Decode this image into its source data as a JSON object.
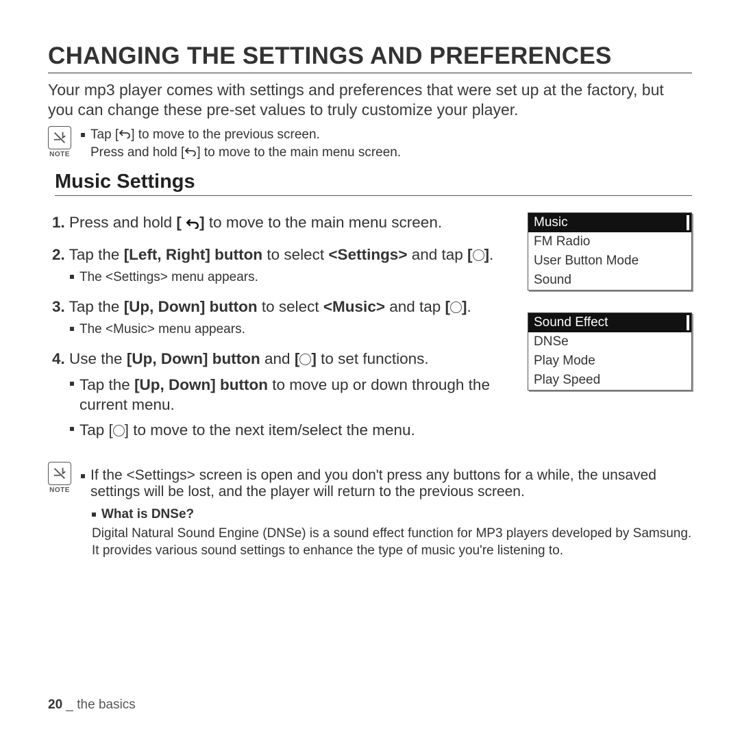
{
  "title": "CHANGING THE SETTINGS AND PREFERENCES",
  "intro": "Your mp3 player comes with settings and preferences that were set up at the factory, but you can change these pre-set values to truly customize your player.",
  "topNote": {
    "label": "NOTE",
    "l1a": "Tap [",
    "l1b": "] to move to the previous screen.",
    "l2a": "Press and hold [",
    "l2b": "] to move to the main menu screen."
  },
  "subheading": "Music Settings",
  "steps": {
    "s1": {
      "num": "1.",
      "a": "Press and hold ",
      "b": "[",
      "c": "]",
      "d": " to move to the main menu screen."
    },
    "s2": {
      "num": "2.",
      "a": "Tap the ",
      "bold1": "[Left, Right] button",
      "b": " to select ",
      "bold2": "<Settings>",
      "c": " and tap ",
      "d": "[",
      "e": "]",
      "f": ".",
      "sub": "The <Settings> menu appears."
    },
    "s3": {
      "num": "3.",
      "a": "Tap the ",
      "bold1": "[Up, Down] button",
      "b": " to select ",
      "bold2": "<Music>",
      "c": " and tap ",
      "d": "[",
      "e": "]",
      "f": ".",
      "sub": "The <Music> menu appears."
    },
    "s4": {
      "num": "4.",
      "a": "Use the ",
      "bold1": "[Up, Down] button",
      "b": " and ",
      "c": "[",
      "d": "]",
      "e": " to set functions.",
      "sub1a": "Tap the ",
      "sub1bold": "[Up, Down] button",
      "sub1b": " to move up or down through the current menu.",
      "sub2a": "Tap [",
      "sub2b": "] to move to the next item/select the menu."
    }
  },
  "screens": {
    "a": {
      "r1": "Music",
      "r2": "FM Radio",
      "r3": "User Button Mode",
      "r4": "Sound"
    },
    "b": {
      "r1": "Sound Effect",
      "r2": "DNSe",
      "r3": "Play Mode",
      "r4": "Play Speed"
    }
  },
  "bottomNote": {
    "label": "NOTE",
    "text": "If the <Settings> screen is open and you don't press any buttons for a while, the unsaved settings will be lost, and the player will return to the previous screen.",
    "q": "What is DNSe?",
    "a": "Digital Natural Sound Engine (DNSe) is a sound effect function for MP3 players developed by Samsung. It provides various sound settings to enhance the type of music you're listening to."
  },
  "footer": {
    "page": "20",
    "sep": " _ ",
    "section": "the basics"
  }
}
